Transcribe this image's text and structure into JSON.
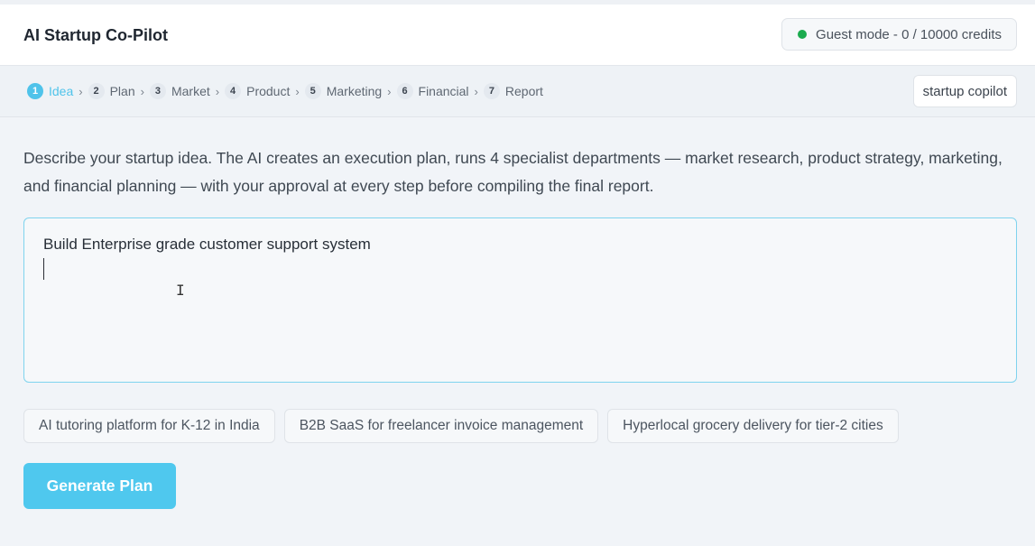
{
  "app": {
    "title": "AI Startup Co-Pilot"
  },
  "credits": {
    "text": "Guest mode - 0 / 10000 credits",
    "status_color": "#1bab4e"
  },
  "steps": [
    {
      "num": "1",
      "label": "Idea",
      "active": true
    },
    {
      "num": "2",
      "label": "Plan",
      "active": false
    },
    {
      "num": "3",
      "label": "Market",
      "active": false
    },
    {
      "num": "4",
      "label": "Product",
      "active": false
    },
    {
      "num": "5",
      "label": "Marketing",
      "active": false
    },
    {
      "num": "6",
      "label": "Financial",
      "active": false
    },
    {
      "num": "7",
      "label": "Report",
      "active": false
    }
  ],
  "step_separator": "›",
  "tag_button": {
    "label": "startup copilot"
  },
  "description": "Describe your startup idea. The AI creates an execution plan, runs 4 specialist departments — market research, product strategy, marketing, and financial planning — with your approval at every step before compiling the final report.",
  "idea_input": {
    "value": "Build Enterprise grade customer support system"
  },
  "suggestions": [
    "AI tutoring platform for K-12 in India",
    "B2B SaaS for freelancer invoice management",
    "Hyperlocal grocery delivery for tier-2 cities"
  ],
  "generate_button": {
    "label": "Generate Plan"
  },
  "colors": {
    "accent": "#4fc8ee",
    "active_step": "#4fc3ea"
  },
  "icons": {
    "status": "status-dot-icon",
    "cursor": "text-cursor-icon"
  }
}
